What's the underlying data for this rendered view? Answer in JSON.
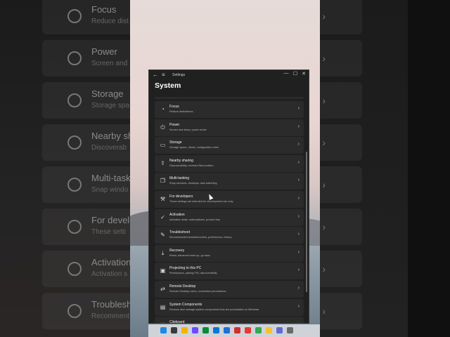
{
  "window": {
    "title": "Settings",
    "page_title": "System",
    "controls": {
      "minimize": "—",
      "maximize": "☐",
      "close": "✕"
    },
    "back": "←",
    "menu": "≡"
  },
  "items": [
    {
      "icon": "focus-icon",
      "glyph": "◔",
      "title": "Focus",
      "subtitle": "Reduce distractions"
    },
    {
      "icon": "power-icon",
      "glyph": "⏻",
      "title": "Power",
      "subtitle": "Screen and sleep, power mode"
    },
    {
      "icon": "storage-icon",
      "glyph": "▭",
      "title": "Storage",
      "subtitle": "Storage space, drives, configuration rules"
    },
    {
      "icon": "nearby-sharing-icon",
      "glyph": "⇪",
      "title": "Nearby sharing",
      "subtitle": "Discoverability, received files location"
    },
    {
      "icon": "multitasking-icon",
      "glyph": "❐",
      "title": "Multi-tasking",
      "subtitle": "Snap windows, desktops, task switching"
    },
    {
      "icon": "developers-icon",
      "glyph": "⚒",
      "title": "For developers",
      "subtitle": "These settings are intended for development use only"
    },
    {
      "icon": "activation-icon",
      "glyph": "✓",
      "title": "Activation",
      "subtitle": "Activation state, subscriptions, product key"
    },
    {
      "icon": "troubleshoot-icon",
      "glyph": "✎",
      "title": "Troubleshoot",
      "subtitle": "Recommended troubleshooters, preferences, history"
    },
    {
      "icon": "recovery-icon",
      "glyph": "⤓",
      "title": "Recovery",
      "subtitle": "Reset, advanced start-up, go back"
    },
    {
      "icon": "projecting-icon",
      "glyph": "▣",
      "title": "Projecting to this PC",
      "subtitle": "Permissions, pairing PIN, discoverability"
    },
    {
      "icon": "remote-desktop-icon",
      "glyph": "⇄",
      "title": "Remote Desktop",
      "subtitle": "Remote Desktop users, connection permissions"
    },
    {
      "icon": "system-components-icon",
      "glyph": "▤",
      "title": "System Components",
      "subtitle": "Remove and manage system components that are preinstalled on Windows"
    },
    {
      "icon": "clipboard-icon",
      "glyph": "▦",
      "title": "Clipboard",
      "subtitle": ""
    }
  ],
  "background_items": [
    {
      "title": "Focus",
      "subtitle": "Reduce dist"
    },
    {
      "title": "Power",
      "subtitle": "Screen and"
    },
    {
      "title": "Storage",
      "subtitle": "Storage spa"
    },
    {
      "title": "Nearby sha",
      "subtitle": "Discoverab"
    },
    {
      "title": "Multi-task",
      "subtitle": "Snap windo"
    },
    {
      "title": "For develo",
      "subtitle": "These setti"
    },
    {
      "title": "Activation",
      "subtitle": "Activation s"
    },
    {
      "title": "Troublesho",
      "subtitle": "Recomment"
    }
  ],
  "chevron": "›",
  "taskbar_colors": [
    "#1e88e5",
    "#3b3b3b",
    "#f4b400",
    "#6d4aff",
    "#0b8a3e",
    "#0078d4",
    "#1e6fd9",
    "#d32f2f",
    "#e53935",
    "#34a853",
    "#f1c232",
    "#5b6bd5",
    "#6a6a6a"
  ]
}
